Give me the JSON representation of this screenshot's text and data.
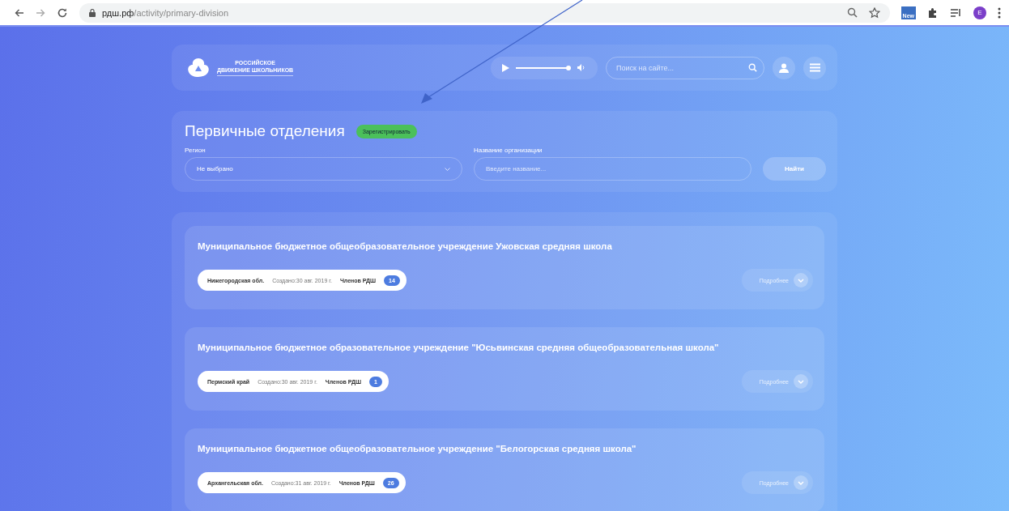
{
  "browser": {
    "url_host": "рдш.рф",
    "url_path": "/activity/primary-division",
    "profile_initial": "E",
    "extension_label": "New"
  },
  "header": {
    "logo_line_1": "РОССИЙСКОЕ",
    "logo_line_2": "ДВИЖЕНИЕ ШКОЛЬНИКОВ",
    "player": {
      "level": 0.95
    },
    "search": {
      "placeholder": "Поиск на сайте..."
    }
  },
  "filter": {
    "title": "Первичные отделения",
    "register_button": "Зарегистрировать",
    "region_label": "Регион",
    "region_value": "Не выбрано",
    "org_label": "Название организации",
    "org_placeholder": "Введите название...",
    "find_button": "Найти"
  },
  "organizations": [
    {
      "name": "Муниципальное бюджетное общеобразовательное учреждение Ужовская средняя школа",
      "region": "Нижегородская обл.",
      "created": "Создано:30 авг. 2019 г.",
      "members_label": "Членов РДШ",
      "members": "14",
      "details_button": "Подробнее"
    },
    {
      "name": "Муниципальное бюджетное образовательное учреждение \"Юсьвинская средняя общеобразовательная школа\"",
      "region": "Пермский край",
      "created": "Создано:30 авг. 2019 г.",
      "members_label": "Членов РДШ",
      "members": "1",
      "details_button": "Подробнее"
    },
    {
      "name": "Муниципальное бюджетное общеобразовательное учреждение \"Белогорская средняя школа\"",
      "region": "Архангельская обл.",
      "created": "Создано:31 авг. 2019 г.",
      "members_label": "Членов РДШ",
      "members": "26",
      "details_button": "Подробнее"
    }
  ]
}
